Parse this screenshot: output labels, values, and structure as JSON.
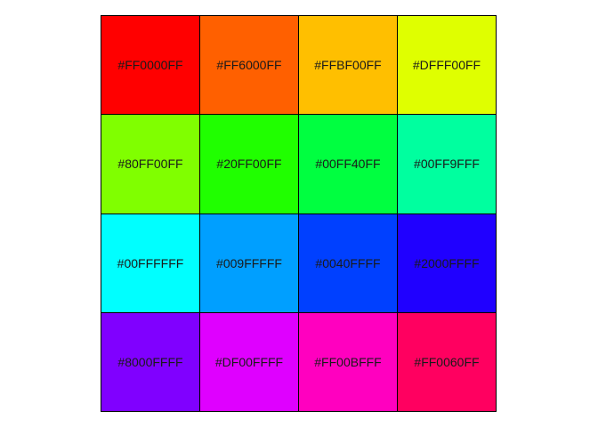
{
  "swatches": [
    {
      "label": "#FF0000FF",
      "color": "#FF0000"
    },
    {
      "label": "#FF6000FF",
      "color": "#FF6000"
    },
    {
      "label": "#FFBF00FF",
      "color": "#FFBF00"
    },
    {
      "label": "#DFFF00FF",
      "color": "#DFFF00"
    },
    {
      "label": "#80FF00FF",
      "color": "#80FF00"
    },
    {
      "label": "#20FF00FF",
      "color": "#20FF00"
    },
    {
      "label": "#00FF40FF",
      "color": "#00FF40"
    },
    {
      "label": "#00FF9FFF",
      "color": "#00FF9F"
    },
    {
      "label": "#00FFFFFF",
      "color": "#00FFFF"
    },
    {
      "label": "#009FFFFF",
      "color": "#009FFF"
    },
    {
      "label": "#0040FFFF",
      "color": "#0040FF"
    },
    {
      "label": "#2000FFFF",
      "color": "#2000FF"
    },
    {
      "label": "#8000FFFF",
      "color": "#8000FF"
    },
    {
      "label": "#DF00FFFF",
      "color": "#DF00FF"
    },
    {
      "label": "#FF00BFFF",
      "color": "#FF00BF"
    },
    {
      "label": "#FF0060FF",
      "color": "#FF0060"
    }
  ]
}
